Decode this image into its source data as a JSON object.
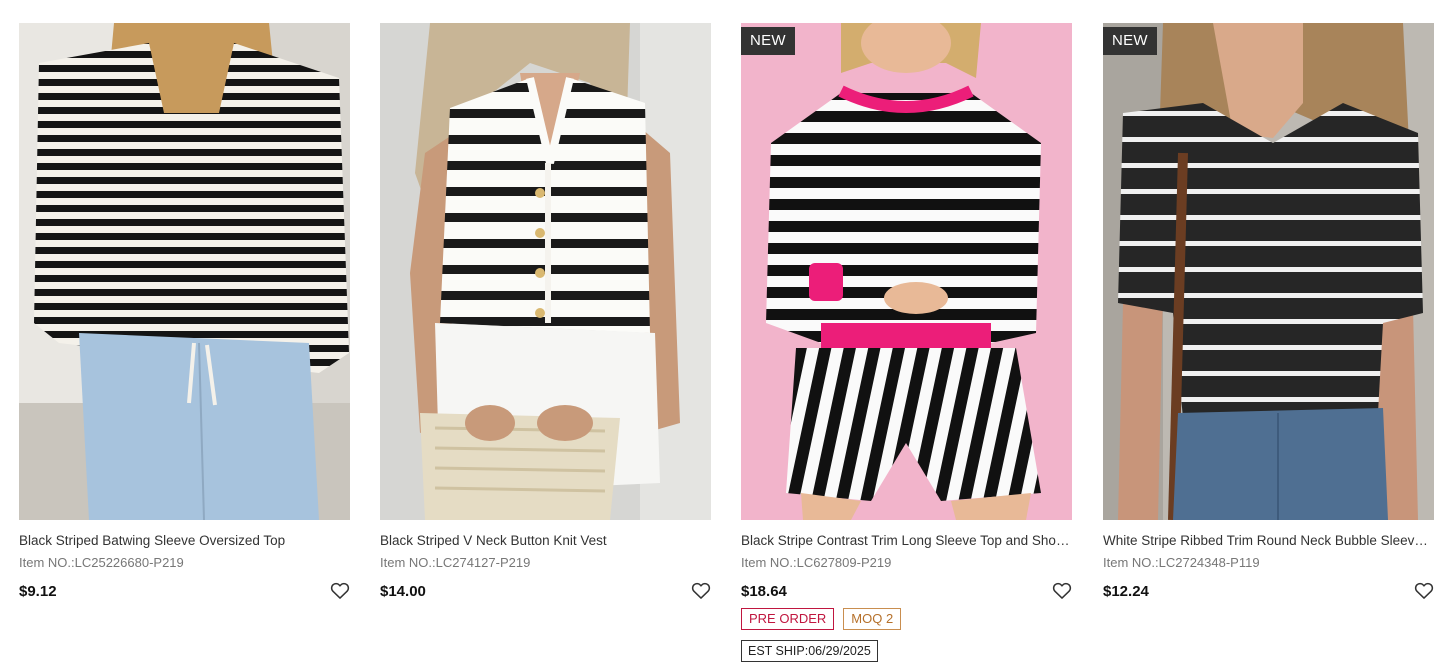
{
  "products": [
    {
      "title": "Black Striped Batwing Sleeve Oversized Top",
      "item_no": "Item NO.:LC25226680-P219",
      "price": "$9.12",
      "badge": ""
    },
    {
      "title": "Black Striped V Neck Button Knit Vest",
      "item_no": "Item NO.:LC274127-P219",
      "price": "$14.00",
      "badge": ""
    },
    {
      "title": "Black Stripe Contrast Trim Long Sleeve Top and Shor…",
      "item_no": "Item NO.:LC627809-P219",
      "price": "$18.64",
      "badge": "NEW",
      "tags": [
        "PRE ORDER",
        "MOQ 2"
      ],
      "ship": "EST SHIP:06/29/2025"
    },
    {
      "title": "White Stripe Ribbed Trim Round Neck Bubble Sleeve…",
      "item_no": "Item NO.:LC2724348-P119",
      "price": "$12.24",
      "badge": "NEW"
    }
  ],
  "icons": {
    "favorite": "heart-outline-icon"
  },
  "colors": {
    "badge_bg": "#333333",
    "pre_order": "#c0163f",
    "moq": "#b5702a"
  }
}
